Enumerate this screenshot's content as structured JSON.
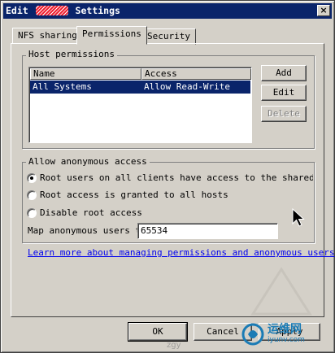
{
  "window": {
    "title_prefix": "Edit ",
    "title_suffix": " Settings",
    "close_glyph": "×"
  },
  "tabs": [
    {
      "label": "NFS sharing"
    },
    {
      "label": "Permissions"
    },
    {
      "label": "Security"
    }
  ],
  "host_permissions": {
    "group_label": "Host permissions",
    "columns": [
      "Name",
      "Access"
    ],
    "rows": [
      {
        "name": "All Systems",
        "access": "Allow Read-Write"
      }
    ],
    "buttons": {
      "add": "Add",
      "edit": "Edit",
      "delete": "Delete"
    }
  },
  "anonymous": {
    "group_label": "Allow anonymous access",
    "options": [
      {
        "label": "Root users on all clients have access to the shared directory",
        "checked": true
      },
      {
        "label": "Root access is granted to all hosts",
        "checked": false
      },
      {
        "label": "Disable root access",
        "checked": false
      }
    ],
    "map_label": "Map anonymous users to:",
    "map_value": "65534"
  },
  "link_text": "Learn more about managing permissions and anonymous users",
  "footer": {
    "ok": "OK",
    "cancel": "Cancel",
    "apply": "Apply"
  },
  "watermark": {
    "cn": "运维网",
    "en": "iyunv.com",
    "en2": "zgy"
  },
  "colors": {
    "titlebar": "#0a246a",
    "face": "#d4d0c8",
    "selection": "#0a246a",
    "link": "#0000ee"
  }
}
